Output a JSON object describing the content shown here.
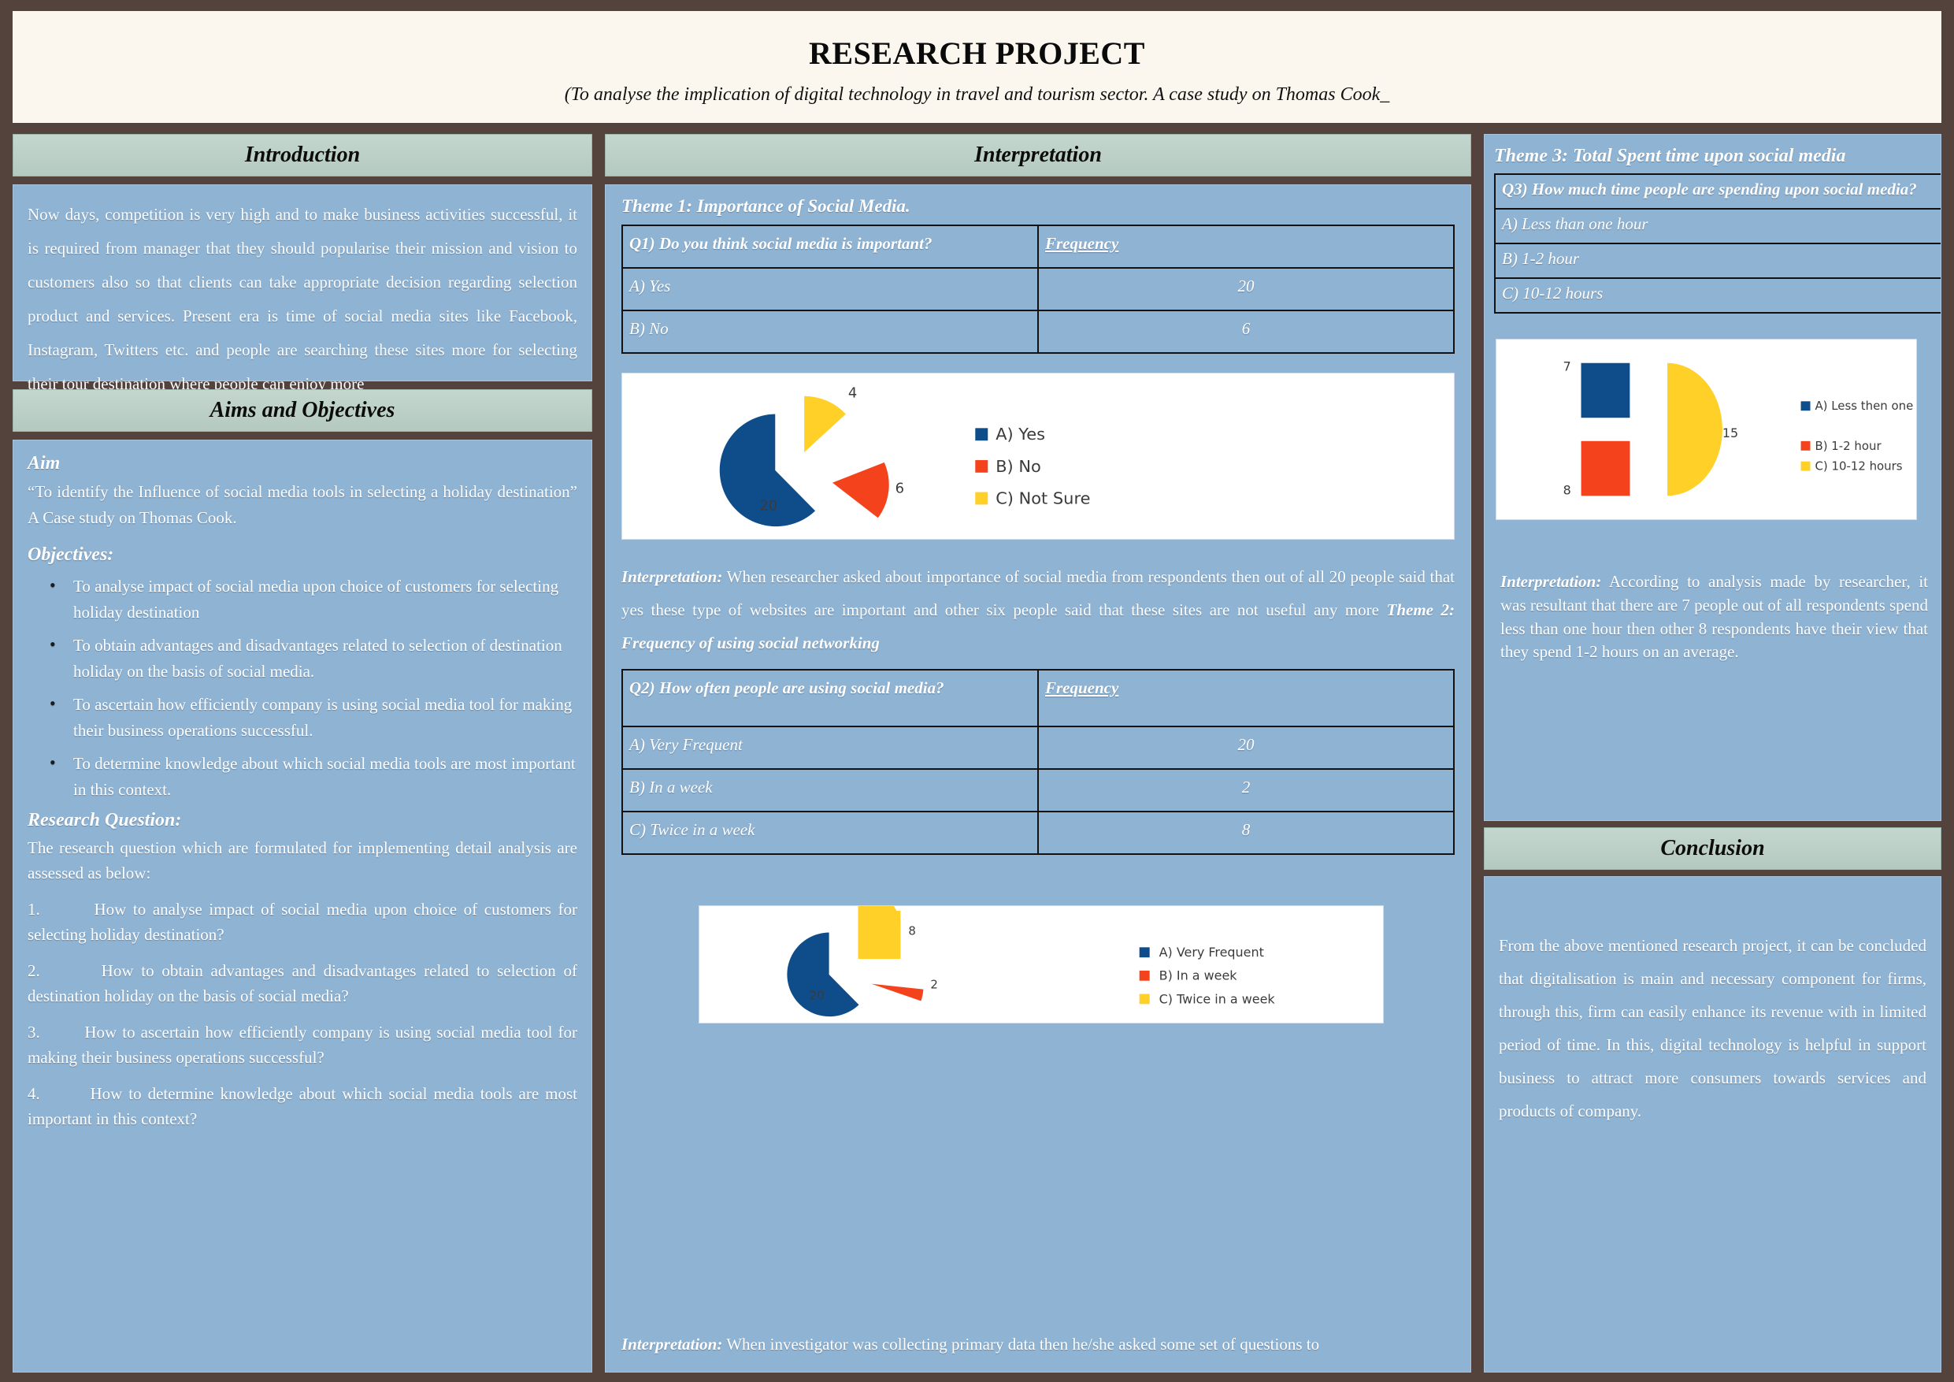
{
  "banner": {
    "title": "RESEARCH PROJECT",
    "subtitle": "(To analyse the implication of digital technology in travel and tourism sector. A case study on Thomas Cook_"
  },
  "colors": {
    "page_bg": "#54423c",
    "banner_bg": "#fbf6ee",
    "header_bar": "#b9cec6",
    "panel_bg": "#8fb3d2",
    "series_a": "#0f4c8a",
    "series_b": "#f4431c",
    "series_c": "#ffd028"
  },
  "introduction": {
    "heading": "Introduction",
    "text": "Now days, competition is very high and to make business activities successful, it is required from manager that they should popularise their mission and vision to customers also so that clients can take appropriate decision regarding selection product and services. Present era is time of social media sites like Facebook, Instagram, Twitters etc. and people are searching these sites more for selecting their tour destination where people can enjoy more"
  },
  "aims": {
    "heading": "Aims and Objectives",
    "aim_label": "Aim",
    "aim_text": "“To identify the Influence of social media tools in selecting a holiday destination” A Case study on Thomas Cook.",
    "objectives_label": "Objectives:",
    "objectives": [
      "To analyse impact of social media upon choice of customers for selecting holiday destination",
      "To obtain advantages and disadvantages related to selection of destination holiday on the basis of social media.",
      "To ascertain how efficiently company is using social media tool for making their business operations successful.",
      "To determine knowledge about which social media tools are most important in this context."
    ],
    "research_question_label": "Research Question:",
    "research_question_intro": "The research question which are formulated for implementing detail analysis are assessed as below:",
    "questions": [
      "1.        How to analyse impact of social media upon choice of customers for selecting holiday destination?",
      "2.        How to obtain advantages and disadvantages related to selection of destination holiday on the basis of social media?",
      "3.        How to ascertain how efficiently company is using social media tool for making their business operations successful?",
      "4.        How to determine knowledge about which social media tools are most important in this context?"
    ]
  },
  "interpretation": {
    "heading": "Interpretation",
    "theme1_label": "Theme 1: Importance of Social Media.",
    "table1": {
      "question": "Q1) Do you think social media is important?",
      "frequency_header": "Frequency",
      "rows": [
        {
          "option": "A) Yes",
          "frequency": "20"
        },
        {
          "option": "B) No",
          "frequency": "6"
        }
      ]
    },
    "interp1_label": "Interpretation:",
    "interp1_text": "When researcher asked about importance of social media from respondents then out of all 20 people said that yes these type of websites are important and other six people said that these sites are not useful any more ",
    "theme2_label": "Theme 2: Frequency of using social networking",
    "table2": {
      "question": "Q2) How often people are using social media?",
      "frequency_header": "Frequency",
      "rows": [
        {
          "option": "A) Very Frequent",
          "frequency": "20"
        },
        {
          "option": "B) In a week",
          "frequency": "2"
        },
        {
          "option": "C) Twice in a week",
          "frequency": "8"
        }
      ]
    },
    "interp2_label": "Interpretation:",
    "interp2_text": " When investigator was collecting primary data then he/she asked some set of questions to"
  },
  "theme3": {
    "label": "Theme 3:  Total Spent time upon social media",
    "table3": {
      "question": "Q3) How much time people are spending upon social media?",
      "rows": [
        {
          "option": " A) Less than one hour"
        },
        {
          "option": "B) 1-2 hour"
        },
        {
          "option": " C) 10-12 hours"
        }
      ]
    },
    "interp3_label": "Interpretation:",
    "interp3_text": "   According to analysis made by researcher, it was resultant that there are 7 people out of all respondents spend less than one hour then other 8 respondents have their view that they spend 1-2 hours on an average."
  },
  "conclusion": {
    "heading": "Conclusion",
    "text": "From the above mentioned research project, it can be concluded that digitalisation is main and necessary component for firms, through this, firm can easily enhance its revenue with in limited period of time. In this, digital technology is helpful in support business to attract more consumers towards services and products of company."
  },
  "chart_data": [
    {
      "type": "pie",
      "title": "Q1) Do you think social media is important?",
      "categories": [
        "A) Yes",
        "B) No",
        "C) Not Sure"
      ],
      "values": [
        20,
        6,
        4
      ],
      "labels": [
        "20",
        "6",
        "4"
      ],
      "colors": [
        "#0f4c8a",
        "#f4431c",
        "#ffd028"
      ],
      "legend_position": "right",
      "exploded": true
    },
    {
      "type": "pie",
      "title": "Q2) How often people are using social media?",
      "categories": [
        "A) Very Frequent",
        "B) In a week",
        "C) Twice in a week"
      ],
      "values": [
        20,
        2,
        8
      ],
      "labels": [
        "20",
        "2",
        "8"
      ],
      "colors": [
        "#0f4c8a",
        "#f4431c",
        "#ffd028"
      ],
      "legend_position": "right",
      "exploded": true
    },
    {
      "type": "pie",
      "title": "Q3) How much time people are spending upon social media?",
      "categories": [
        "A) Less then one hour",
        "B) 1-2 hour",
        "C) 10-12 hours"
      ],
      "values": [
        7,
        8,
        15
      ],
      "labels": [
        "7",
        "8",
        "15"
      ],
      "colors": [
        "#0f4c8a",
        "#f4431c",
        "#ffd028"
      ],
      "legend_position": "right",
      "exploded": true
    }
  ]
}
